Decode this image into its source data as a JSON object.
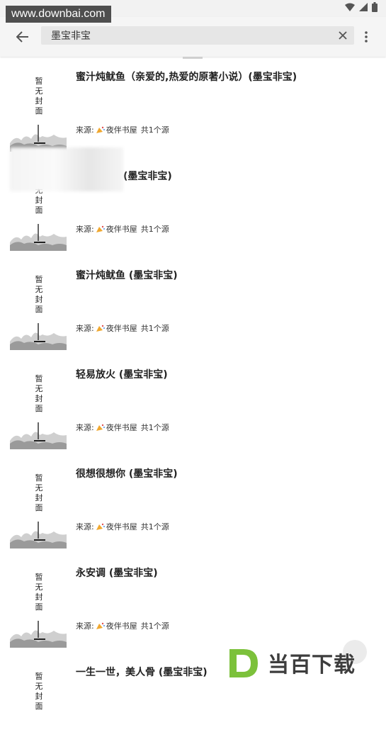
{
  "watermark": {
    "text": "www.downbai.com"
  },
  "toolbar": {
    "search_value": "墨宝非宝"
  },
  "results": [
    {
      "cover_text": "暂无封面",
      "title": "蜜汁炖鱿鱼（亲爱的,热爱的原著小说）(墨宝非宝)",
      "source_label": "来源:",
      "source_name": "夜伴书屋",
      "source_count": "共1个源"
    },
    {
      "cover_text": "暂无封面",
      "title": "(墨宝非宝)",
      "source_label": "来源:",
      "source_name": "夜伴书屋",
      "source_count": "共1个源"
    },
    {
      "cover_text": "暂无封面",
      "title": "蜜汁炖鱿鱼 (墨宝非宝)",
      "source_label": "来源:",
      "source_name": "夜伴书屋",
      "source_count": "共1个源"
    },
    {
      "cover_text": "暂无封面",
      "title": "轻易放火 (墨宝非宝)",
      "source_label": "来源:",
      "source_name": "夜伴书屋",
      "source_count": "共1个源"
    },
    {
      "cover_text": "暂无封面",
      "title": "很想很想你 (墨宝非宝)",
      "source_label": "来源:",
      "source_name": "夜伴书屋",
      "source_count": "共1个源"
    },
    {
      "cover_text": "暂无封面",
      "title": "永安调 (墨宝非宝)",
      "source_label": "来源:",
      "source_name": "夜伴书屋",
      "source_count": "共1个源"
    },
    {
      "cover_text": "暂无封面",
      "title": "一生一世，美人骨 (墨宝非宝)",
      "source_label": "",
      "source_name": "",
      "source_count": ""
    }
  ],
  "logo": {
    "letter": "D",
    "text": "当百下载",
    "color": "#7cc13b"
  },
  "icons": {
    "back": "arrow-left-icon",
    "clear": "close-icon",
    "more": "more-vert-icon",
    "source": "party-popper-icon"
  }
}
